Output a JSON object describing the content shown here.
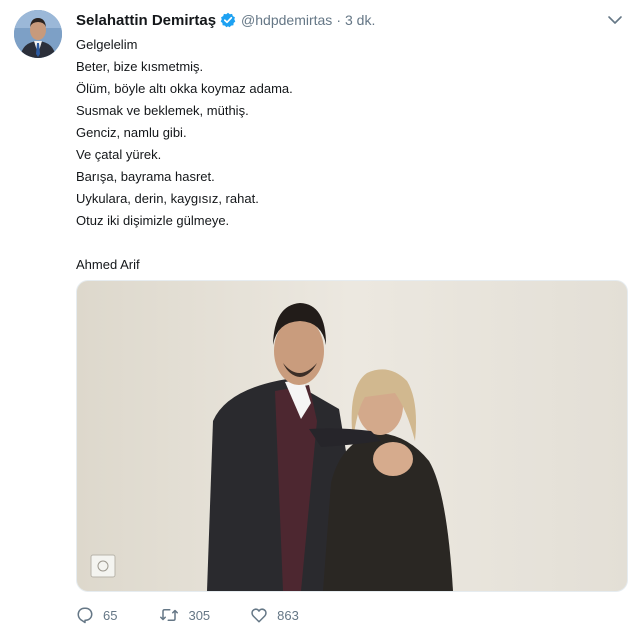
{
  "tweet": {
    "author_name": "Selahattin Demirtaş",
    "handle": "@hdpdemirtas",
    "separator": "·",
    "time": "3 dk.",
    "lines": [
      "Gelgelelim",
      "Beter, bize kısmetmiş.",
      "Ölüm, böyle altı okka koymaz adama.",
      "Susmak ve beklemek, müthiş.",
      "Genciz, namlu gibi.",
      "Ve çatal yürek.",
      "Barışa, bayrama hasret.",
      "Uykulara, derin, kaygısız, rahat.",
      "Otuz iki dişimizle gülmeye."
    ],
    "signature": "Ahmed Arif",
    "stats": {
      "replies": "65",
      "retweets": "305",
      "likes": "863"
    }
  },
  "icons": {
    "verified": "verified-badge-icon",
    "menu": "chevron-down-icon",
    "reply": "reply-icon",
    "retweet": "retweet-icon",
    "like": "heart-icon"
  },
  "colors": {
    "text": "#14171a",
    "muted": "#657786",
    "verified": "#1da1f2"
  }
}
